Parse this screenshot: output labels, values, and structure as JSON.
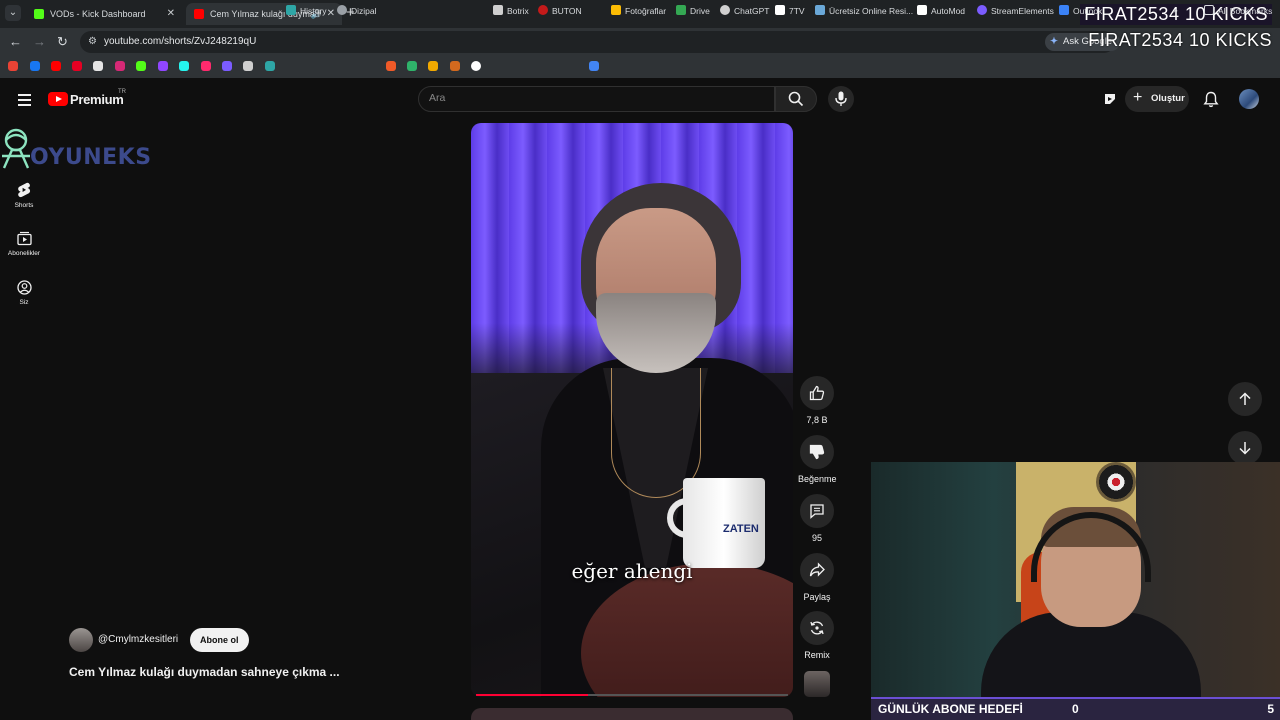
{
  "browser": {
    "tabs": [
      {
        "title": "VODs - Kick Dashboard",
        "favicon_color": "#53fc18",
        "active": false
      },
      {
        "title": "Cem Yılmaz kulağı duymad",
        "favicon_color": "#ff0000",
        "active": true
      }
    ],
    "url": "youtube.com/shorts/ZvJ248219qU",
    "ask_google": "Ask Google",
    "bookmarks": [
      {
        "label": "History",
        "icon": "history-icon",
        "color": "#2ea6a6"
      },
      {
        "label": "Dizipal",
        "icon": "globe-icon",
        "color": "#9aa0a6"
      },
      {
        "label": "Botrix",
        "icon": "botrix-icon",
        "color": "#cfcfcf"
      },
      {
        "label": "BUTON",
        "icon": "buton-icon",
        "color": "#c41a1a"
      },
      {
        "label": "Fotoğraflar",
        "icon": "photos-icon",
        "color": "#fbbc04"
      },
      {
        "label": "Drive",
        "icon": "drive-icon",
        "color": "#34a853"
      },
      {
        "label": "ChatGPT",
        "icon": "chatgpt-icon",
        "color": "#d0d0d0"
      },
      {
        "label": "7TV",
        "icon": "7tv-icon",
        "color": "#ffffff"
      },
      {
        "label": "Ücretsiz Online Resi...",
        "icon": "rp-icon",
        "color": "#6aa8d8"
      },
      {
        "label": "AutoMod",
        "icon": "automod-icon",
        "color": "#ffffff"
      },
      {
        "label": "StreamElements",
        "icon": "streamelements-icon",
        "color": "#7b5cff"
      },
      {
        "label": "Outlook",
        "icon": "outlook-icon",
        "color": "#3b82f6"
      }
    ],
    "all_bookmarks": "All Bookmarks",
    "more_bookmarks": "»"
  },
  "overlay": {
    "kick_line_1": "FIRAT2534  10 KICKS",
    "kick_line_2": "FIRAT2534  10 KICKS",
    "watermark": "OYUNEKS",
    "goal_label": "GÜNLÜK ABONE HEDEFİ",
    "goal_current": "0",
    "goal_target": "5"
  },
  "youtube": {
    "brand": "Premium",
    "country": "TR",
    "search_placeholder": "Ara",
    "create_label": "Oluştur",
    "sidebar": [
      {
        "label": "Shorts",
        "icon": "shorts-icon"
      },
      {
        "label": "Abonelikler",
        "icon": "subscriptions-icon"
      },
      {
        "label": "Siz",
        "icon": "you-icon"
      }
    ],
    "short": {
      "caption": "eğer ahengi",
      "mug_text": "ZATEN",
      "progress": 0.36,
      "like_count": "7,8 B",
      "dislike_label": "Beğenme",
      "comment_count": "95",
      "share_label": "Paylaş",
      "remix_label": "Remix",
      "channel": "@Cmylmzkesitleri",
      "subscribe_label": "Abone ol",
      "title": "Cem Yılmaz kulağı duymadan sahneye çıkma ..."
    }
  },
  "colors": {
    "yt_red": "#ff0000",
    "background": "#0f0f0f",
    "kick_green": "#53fc18"
  }
}
